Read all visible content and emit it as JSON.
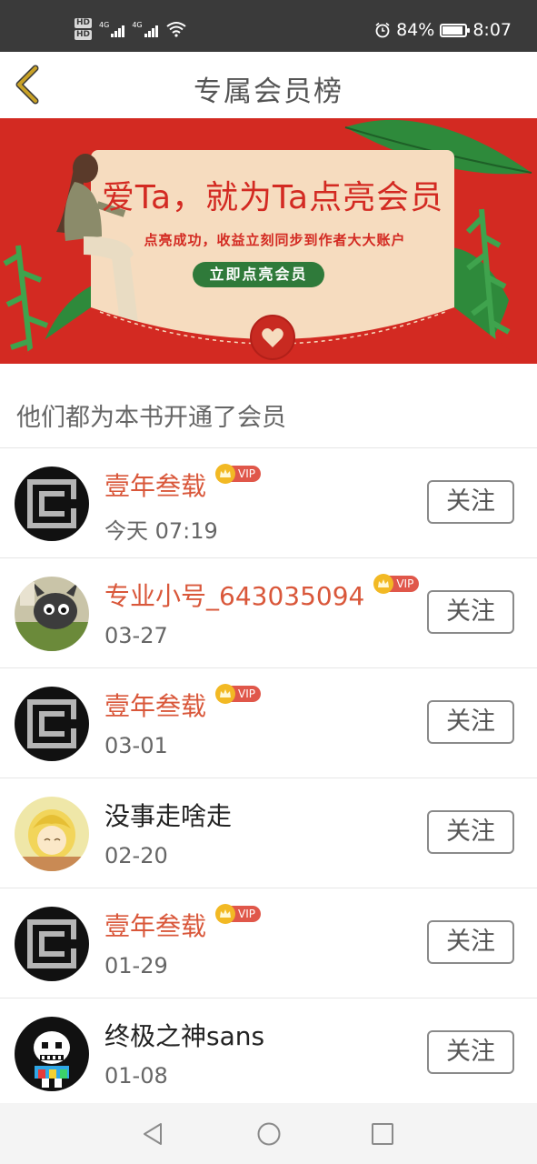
{
  "status_bar": {
    "hd1": "HD",
    "hd2": "HD",
    "net1": "4G",
    "net2": "4G",
    "battery_percent": "84%",
    "battery_level": 0.84,
    "time": "8:07"
  },
  "header": {
    "title": "专属会员榜"
  },
  "banner": {
    "headline": "爱Ta，就为Ta点亮会员",
    "subtitle": "点亮成功，收益立刻同步到作者大大账户",
    "button_label": "立即点亮会员"
  },
  "section": {
    "title": "他们都为本书开通了会员"
  },
  "members": [
    {
      "name": "壹年叁载",
      "vip": true,
      "vip_label": "VIP",
      "date": "今天 07:19",
      "follow_label": "关注",
      "avatar": "pixel-c-avatar"
    },
    {
      "name": "专业小号_643035094",
      "vip": true,
      "vip_label": "VIP",
      "date": "03-27",
      "follow_label": "关注",
      "avatar": "cartoon-cat-avatar"
    },
    {
      "name": "壹年叁载",
      "vip": true,
      "vip_label": "VIP",
      "date": "03-01",
      "follow_label": "关注",
      "avatar": "pixel-c-avatar"
    },
    {
      "name": "没事走啥走",
      "vip": false,
      "vip_label": "",
      "date": "02-20",
      "follow_label": "关注",
      "avatar": "yellow-hair-avatar"
    },
    {
      "name": "壹年叁载",
      "vip": true,
      "vip_label": "VIP",
      "date": "01-29",
      "follow_label": "关注",
      "avatar": "pixel-c-avatar"
    },
    {
      "name": "终极之神sans",
      "vip": false,
      "vip_label": "",
      "date": "01-08",
      "follow_label": "关注",
      "avatar": "skeleton-avatar"
    }
  ],
  "colors": {
    "banner_red": "#d32a22",
    "vip_name": "#d9573a",
    "status_bar": "#3a3a3a",
    "back_arrow": "#c9a227"
  }
}
